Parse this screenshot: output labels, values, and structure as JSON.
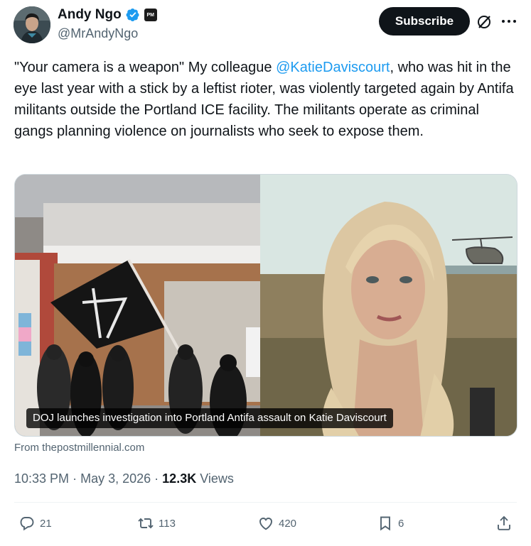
{
  "author": {
    "display_name": "Andy Ngo",
    "handle": "@MrAndyNgo",
    "avatar_icon": "avatar-portrait",
    "verified_icon": "verified-badge-icon",
    "affiliate_badge": "PM"
  },
  "header": {
    "subscribe_label": "Subscribe",
    "grok_icon": "grok-icon",
    "more_icon": "more-horizontal-icon"
  },
  "tweet": {
    "text_before": "\"Your camera is a weapon\" My colleague ",
    "mention": "@KatieDaviscourt",
    "text_after": ", who was hit in the eye last year with a stick by a leftist rioter, was violently targeted again by Antifa militants outside the Portland ICE facility. The militants operate as criminal gangs planning violence on journalists who seek to expose them."
  },
  "media": {
    "caption": "DOJ launches investigation into Portland Antifa assault on Katie Daviscourt",
    "left_image": "protesters-with-flag",
    "right_image": "woman-portrait-helicopter"
  },
  "source": {
    "label": "From thepostmillennial.com"
  },
  "meta": {
    "time": "10:33 PM",
    "separator": "·",
    "date": "May 3, 2026",
    "views_count": "12.3K",
    "views_label": "Views"
  },
  "actions": {
    "replies": "21",
    "reposts": "113",
    "likes": "420",
    "bookmarks": "6"
  },
  "colors": {
    "accent": "#1d9bf0",
    "text": "#0f1419",
    "secondary": "#536471",
    "button": "#0f1419"
  }
}
